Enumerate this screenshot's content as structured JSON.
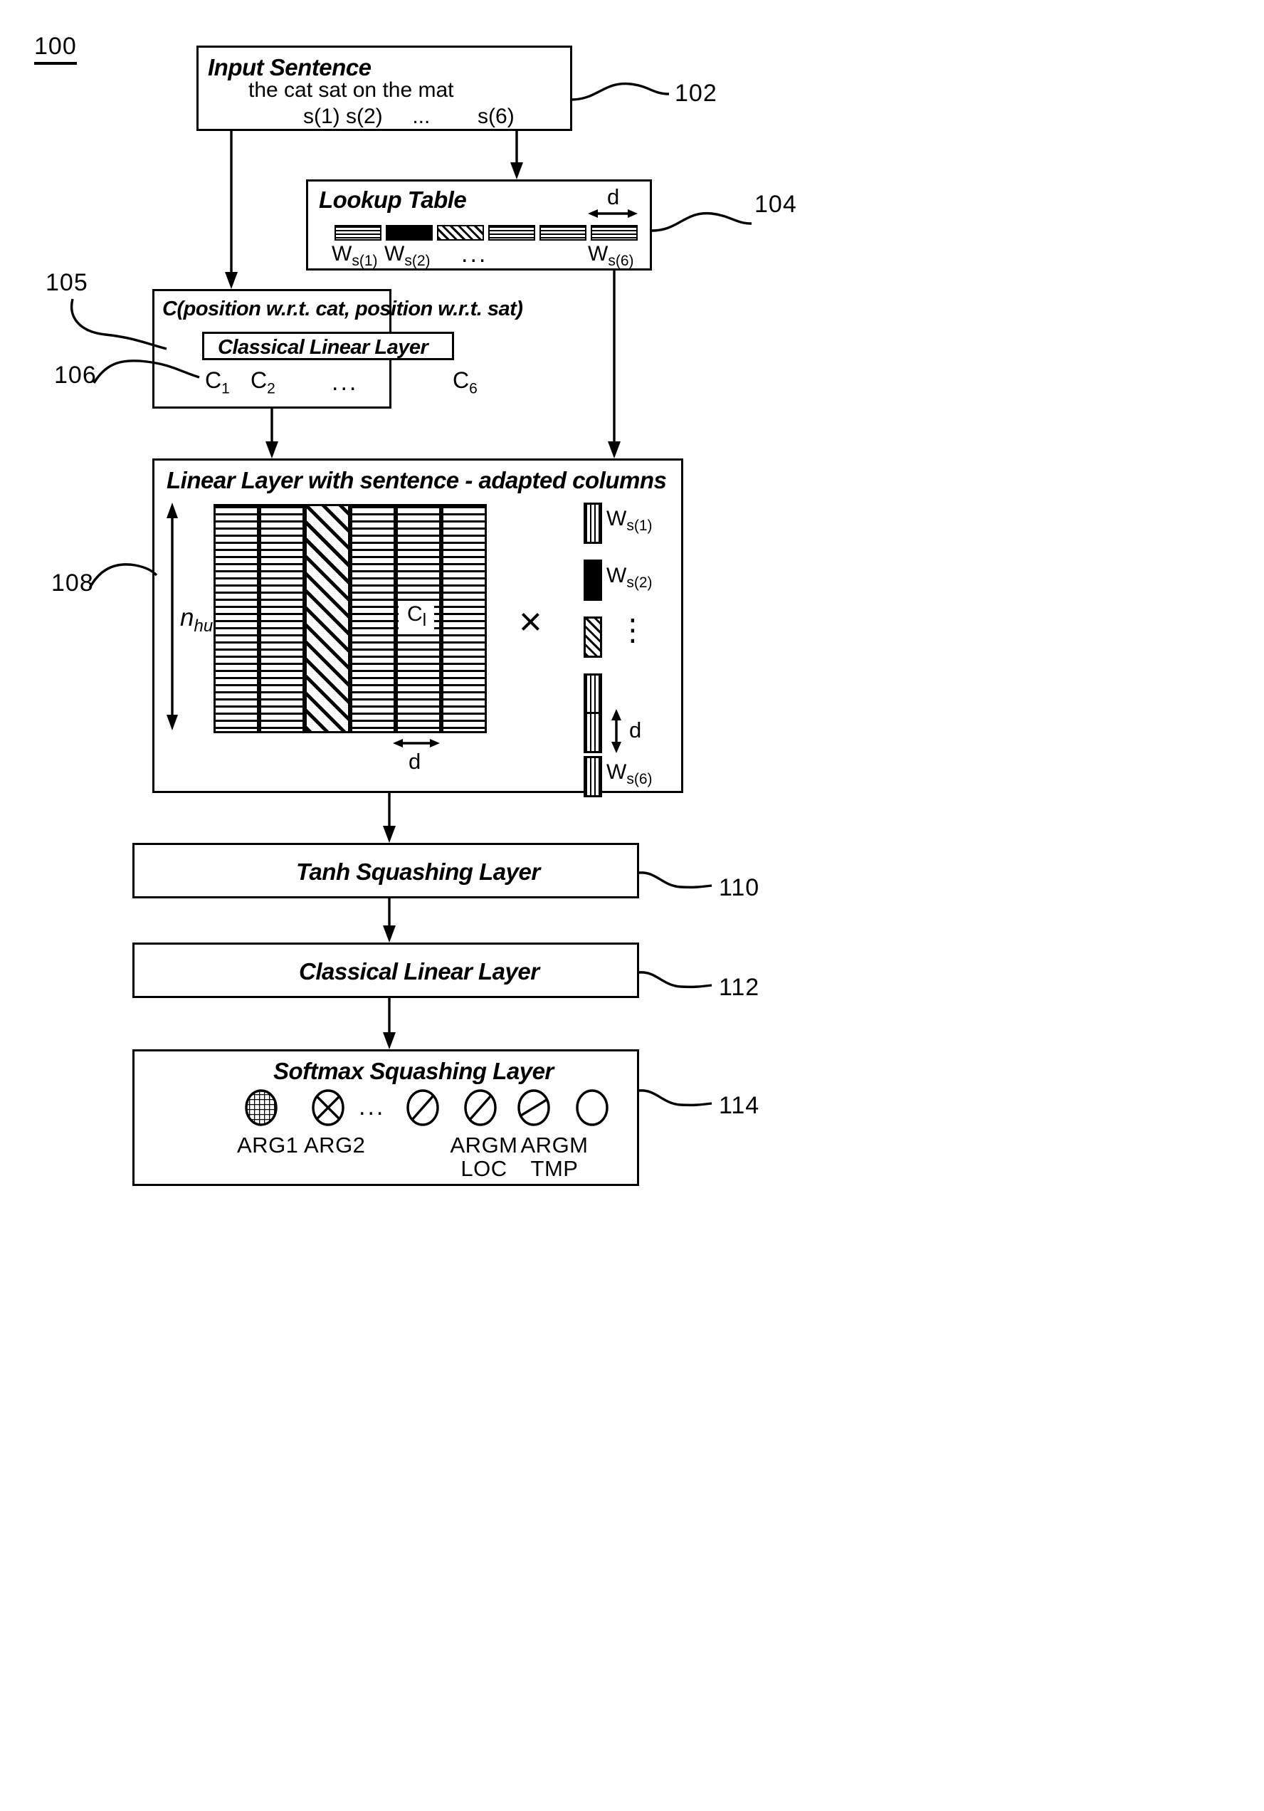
{
  "figure": {
    "number": "100"
  },
  "blocks": {
    "input_sentence": {
      "ref": "102",
      "title": "Input Sentence",
      "sentence": "the cat sat on the mat",
      "tokens": "s(1) s(2)     ...        s(6)"
    },
    "lookup_table": {
      "ref": "104",
      "title": "Lookup Table",
      "dim_label": "d",
      "labels": [
        "W",
        "W",
        "W"
      ],
      "label_texts": [
        "W_s(1)",
        "W_s(2)",
        "W_s(6)"
      ],
      "label_main": "W",
      "label_sub_1": "s(1)",
      "label_sub_2": "s(2)",
      "label_sub_6": "s(6)",
      "ellipsis": "..."
    },
    "context": {
      "ref_outer": "105",
      "ref_inner": "106",
      "title": "C(position w.r.t. cat, position w.r.t. sat)",
      "inner_title": "Classical Linear Layer",
      "c_labels": [
        "C",
        "C",
        "C"
      ],
      "c_main": "C",
      "c_sub_1": "1",
      "c_sub_2": "2",
      "c_sub_6": "6",
      "ellipsis": "..."
    },
    "linear_layer": {
      "ref": "108",
      "title": "Linear Layer with sentence - adapted columns",
      "height_label_main": "n",
      "height_label_sub": "hu",
      "width_label": "d",
      "cell_label_main": "C",
      "cell_label_sub": "l",
      "times_symbol": "×",
      "vector_labels": {
        "main": "W",
        "sub_1": "s(1)",
        "sub_2": "s(2)",
        "sub_6": "s(6)"
      },
      "vertical_dim_label": "d",
      "vdots": "⋮"
    },
    "tanh": {
      "ref": "110",
      "title": "Tanh Squashing Layer"
    },
    "classical_linear": {
      "ref": "112",
      "title": "Classical Linear Layer"
    },
    "softmax": {
      "ref": "114",
      "title": "Softmax Squashing Layer",
      "ellipsis": "...",
      "outputs": [
        {
          "label": "ARG1",
          "label2": ""
        },
        {
          "label": "ARG2",
          "label2": ""
        },
        {
          "label": "ARGM",
          "label2": "LOC"
        },
        {
          "label": "ARGM",
          "label2": "TMP"
        }
      ],
      "arg1": "ARG1",
      "arg2": "ARG2",
      "argm_loc_1": "ARGM",
      "argm_loc_2": "LOC",
      "argm_tmp_1": "ARGM",
      "argm_tmp_2": "TMP"
    }
  }
}
